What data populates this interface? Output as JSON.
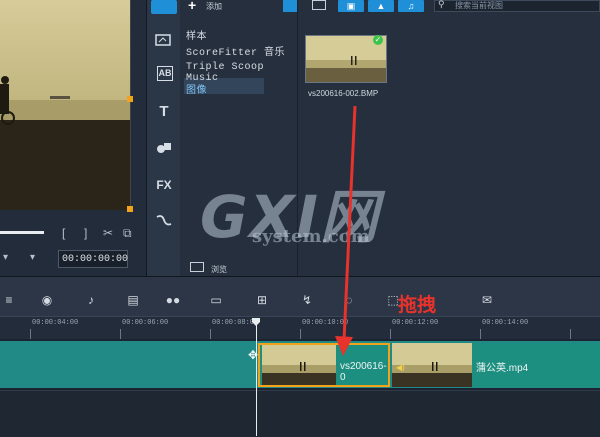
{
  "preview": {
    "timecode": "00:00:00:00",
    "bracket_in": "[",
    "bracket_out": "]",
    "scissors": "✂",
    "copy": "⧉",
    "dropdown_a": "▾",
    "dropdown_b": "▾"
  },
  "toolstrip": {
    "items": [
      "media-icon",
      "instant-project-icon",
      "transition-icon",
      "title-icon",
      "graphics-icon",
      "filter-icon",
      "path-icon"
    ],
    "title_glyph": "T",
    "fx_label": "FX",
    "ab_label": "AB"
  },
  "library": {
    "add_label": "添加",
    "add_glyph": "+",
    "items": [
      "样本",
      "ScoreFitter 音乐",
      "Triple Scoop Music",
      "图像"
    ],
    "selected_index": 3,
    "browse_label": "浏览"
  },
  "media": {
    "search_placeholder": "搜索当前视图",
    "thumbnail_label": "vs200616-002.BMP",
    "check_glyph": "✓"
  },
  "timeline": {
    "ruler_labels": [
      "00:00:04:00",
      "00:00:06:00",
      "00:00:08:00",
      "00:00:10:00",
      "00:00:12:00",
      "00:00:14:00"
    ],
    "clip_image_label": "vs200616-0",
    "clip_video_label": "蒲公英.mp4"
  },
  "annotation": {
    "drag_label": "拖拽",
    "arrow_color": "#e8322c"
  },
  "watermark": {
    "main": "GXI网",
    "sub": "system.com"
  },
  "colors": {
    "accent": "#1f8fd8",
    "selection": "#f2a31c",
    "track": "#218a86"
  }
}
